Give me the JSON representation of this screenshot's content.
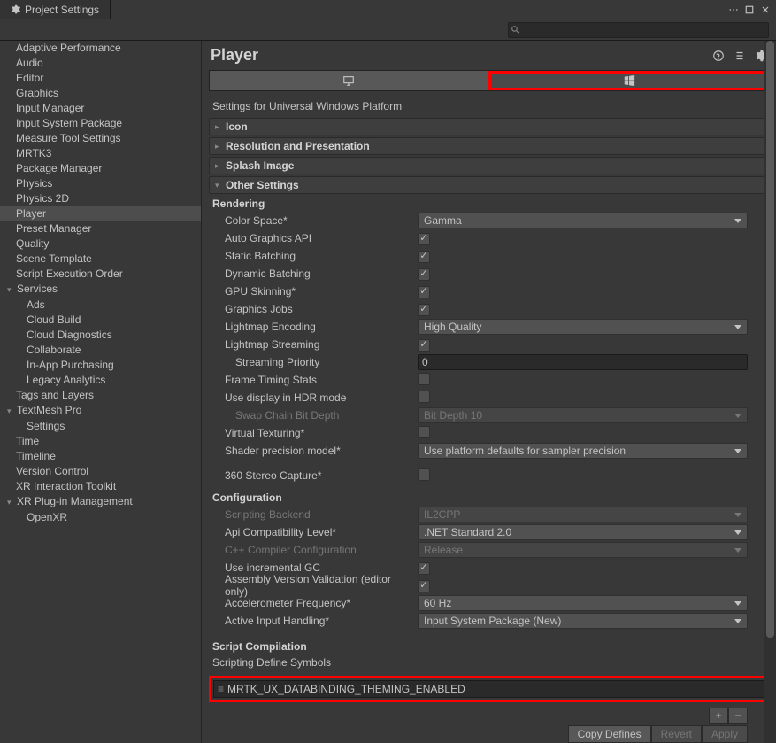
{
  "window": {
    "title": "Project Settings"
  },
  "sidebar": {
    "items": [
      {
        "label": "Adaptive Performance",
        "type": "item"
      },
      {
        "label": "Audio",
        "type": "item"
      },
      {
        "label": "Editor",
        "type": "item"
      },
      {
        "label": "Graphics",
        "type": "item"
      },
      {
        "label": "Input Manager",
        "type": "item"
      },
      {
        "label": "Input System Package",
        "type": "item"
      },
      {
        "label": "Measure Tool Settings",
        "type": "item"
      },
      {
        "label": "MRTK3",
        "type": "item"
      },
      {
        "label": "Package Manager",
        "type": "item"
      },
      {
        "label": "Physics",
        "type": "item"
      },
      {
        "label": "Physics 2D",
        "type": "item"
      },
      {
        "label": "Player",
        "type": "item",
        "selected": true
      },
      {
        "label": "Preset Manager",
        "type": "item"
      },
      {
        "label": "Quality",
        "type": "item"
      },
      {
        "label": "Scene Template",
        "type": "item"
      },
      {
        "label": "Script Execution Order",
        "type": "item"
      },
      {
        "label": "Services",
        "type": "parent"
      },
      {
        "label": "Ads",
        "type": "child"
      },
      {
        "label": "Cloud Build",
        "type": "child"
      },
      {
        "label": "Cloud Diagnostics",
        "type": "child"
      },
      {
        "label": "Collaborate",
        "type": "child"
      },
      {
        "label": "In-App Purchasing",
        "type": "child"
      },
      {
        "label": "Legacy Analytics",
        "type": "child"
      },
      {
        "label": "Tags and Layers",
        "type": "item"
      },
      {
        "label": "TextMesh Pro",
        "type": "parent"
      },
      {
        "label": "Settings",
        "type": "child"
      },
      {
        "label": "Time",
        "type": "item"
      },
      {
        "label": "Timeline",
        "type": "item"
      },
      {
        "label": "Version Control",
        "type": "item"
      },
      {
        "label": "XR Interaction Toolkit",
        "type": "item"
      },
      {
        "label": "XR Plug-in Management",
        "type": "parent"
      },
      {
        "label": "OpenXR",
        "type": "child"
      }
    ]
  },
  "header": {
    "title": "Player"
  },
  "settings_for": "Settings for Universal Windows Platform",
  "foldouts": {
    "icon": "Icon",
    "resolution": "Resolution and Presentation",
    "splash": "Splash Image",
    "other": "Other Settings"
  },
  "rendering": {
    "heading": "Rendering",
    "color_space_label": "Color Space*",
    "color_space_value": "Gamma",
    "auto_graphics_label": "Auto Graphics API",
    "static_batching_label": "Static Batching",
    "dynamic_batching_label": "Dynamic Batching",
    "gpu_skinning_label": "GPU Skinning*",
    "graphics_jobs_label": "Graphics Jobs",
    "lightmap_encoding_label": "Lightmap Encoding",
    "lightmap_encoding_value": "High Quality",
    "lightmap_streaming_label": "Lightmap Streaming",
    "streaming_priority_label": "Streaming Priority",
    "streaming_priority_value": "0",
    "frame_timing_label": "Frame Timing Stats",
    "hdr_mode_label": "Use display in HDR mode",
    "swap_chain_label": "Swap Chain Bit Depth",
    "swap_chain_value": "Bit Depth 10",
    "virtual_texturing_label": "Virtual Texturing*",
    "shader_precision_label": "Shader precision model*",
    "shader_precision_value": "Use platform defaults for sampler precision",
    "stereo360_label": "360 Stereo Capture*"
  },
  "configuration": {
    "heading": "Configuration",
    "scripting_backend_label": "Scripting Backend",
    "scripting_backend_value": "IL2CPP",
    "api_compat_label": "Api Compatibility Level*",
    "api_compat_value": ".NET Standard 2.0",
    "cpp_compiler_label": "C++ Compiler Configuration",
    "cpp_compiler_value": "Release",
    "incremental_gc_label": "Use incremental GC",
    "assembly_validation_label": "Assembly Version Validation (editor only)",
    "accelerometer_label": "Accelerometer Frequency*",
    "accelerometer_value": "60 Hz",
    "active_input_label": "Active Input Handling*",
    "active_input_value": "Input System Package (New)"
  },
  "script_compilation": {
    "heading": "Script Compilation",
    "define_symbols_label": "Scripting Define Symbols",
    "symbol_0": "MRTK_UX_DATABINDING_THEMING_ENABLED",
    "plus": "+",
    "minus": "−",
    "copy_defines": "Copy Defines",
    "revert": "Revert",
    "apply": "Apply"
  }
}
